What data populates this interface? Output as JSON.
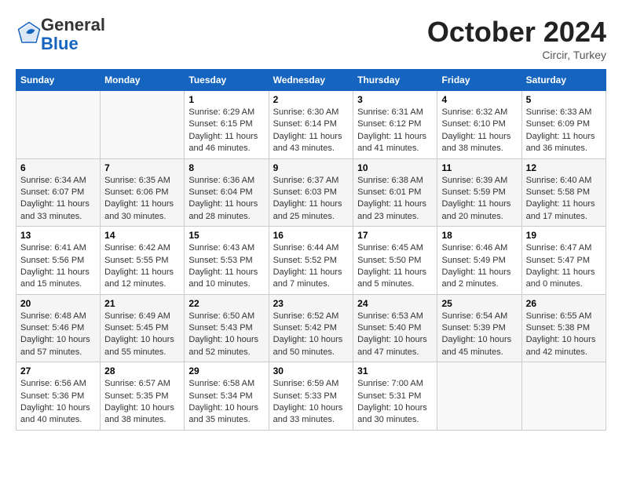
{
  "header": {
    "logo_line1": "General",
    "logo_line2": "Blue",
    "month": "October 2024",
    "location": "Circir, Turkey"
  },
  "days_of_week": [
    "Sunday",
    "Monday",
    "Tuesday",
    "Wednesday",
    "Thursday",
    "Friday",
    "Saturday"
  ],
  "weeks": [
    [
      {
        "day": "",
        "sunrise": "",
        "sunset": "",
        "daylight": ""
      },
      {
        "day": "",
        "sunrise": "",
        "sunset": "",
        "daylight": ""
      },
      {
        "day": "1",
        "sunrise": "Sunrise: 6:29 AM",
        "sunset": "Sunset: 6:15 PM",
        "daylight": "Daylight: 11 hours and 46 minutes."
      },
      {
        "day": "2",
        "sunrise": "Sunrise: 6:30 AM",
        "sunset": "Sunset: 6:14 PM",
        "daylight": "Daylight: 11 hours and 43 minutes."
      },
      {
        "day": "3",
        "sunrise": "Sunrise: 6:31 AM",
        "sunset": "Sunset: 6:12 PM",
        "daylight": "Daylight: 11 hours and 41 minutes."
      },
      {
        "day": "4",
        "sunrise": "Sunrise: 6:32 AM",
        "sunset": "Sunset: 6:10 PM",
        "daylight": "Daylight: 11 hours and 38 minutes."
      },
      {
        "day": "5",
        "sunrise": "Sunrise: 6:33 AM",
        "sunset": "Sunset: 6:09 PM",
        "daylight": "Daylight: 11 hours and 36 minutes."
      }
    ],
    [
      {
        "day": "6",
        "sunrise": "Sunrise: 6:34 AM",
        "sunset": "Sunset: 6:07 PM",
        "daylight": "Daylight: 11 hours and 33 minutes."
      },
      {
        "day": "7",
        "sunrise": "Sunrise: 6:35 AM",
        "sunset": "Sunset: 6:06 PM",
        "daylight": "Daylight: 11 hours and 30 minutes."
      },
      {
        "day": "8",
        "sunrise": "Sunrise: 6:36 AM",
        "sunset": "Sunset: 6:04 PM",
        "daylight": "Daylight: 11 hours and 28 minutes."
      },
      {
        "day": "9",
        "sunrise": "Sunrise: 6:37 AM",
        "sunset": "Sunset: 6:03 PM",
        "daylight": "Daylight: 11 hours and 25 minutes."
      },
      {
        "day": "10",
        "sunrise": "Sunrise: 6:38 AM",
        "sunset": "Sunset: 6:01 PM",
        "daylight": "Daylight: 11 hours and 23 minutes."
      },
      {
        "day": "11",
        "sunrise": "Sunrise: 6:39 AM",
        "sunset": "Sunset: 5:59 PM",
        "daylight": "Daylight: 11 hours and 20 minutes."
      },
      {
        "day": "12",
        "sunrise": "Sunrise: 6:40 AM",
        "sunset": "Sunset: 5:58 PM",
        "daylight": "Daylight: 11 hours and 17 minutes."
      }
    ],
    [
      {
        "day": "13",
        "sunrise": "Sunrise: 6:41 AM",
        "sunset": "Sunset: 5:56 PM",
        "daylight": "Daylight: 11 hours and 15 minutes."
      },
      {
        "day": "14",
        "sunrise": "Sunrise: 6:42 AM",
        "sunset": "Sunset: 5:55 PM",
        "daylight": "Daylight: 11 hours and 12 minutes."
      },
      {
        "day": "15",
        "sunrise": "Sunrise: 6:43 AM",
        "sunset": "Sunset: 5:53 PM",
        "daylight": "Daylight: 11 hours and 10 minutes."
      },
      {
        "day": "16",
        "sunrise": "Sunrise: 6:44 AM",
        "sunset": "Sunset: 5:52 PM",
        "daylight": "Daylight: 11 hours and 7 minutes."
      },
      {
        "day": "17",
        "sunrise": "Sunrise: 6:45 AM",
        "sunset": "Sunset: 5:50 PM",
        "daylight": "Daylight: 11 hours and 5 minutes."
      },
      {
        "day": "18",
        "sunrise": "Sunrise: 6:46 AM",
        "sunset": "Sunset: 5:49 PM",
        "daylight": "Daylight: 11 hours and 2 minutes."
      },
      {
        "day": "19",
        "sunrise": "Sunrise: 6:47 AM",
        "sunset": "Sunset: 5:47 PM",
        "daylight": "Daylight: 11 hours and 0 minutes."
      }
    ],
    [
      {
        "day": "20",
        "sunrise": "Sunrise: 6:48 AM",
        "sunset": "Sunset: 5:46 PM",
        "daylight": "Daylight: 10 hours and 57 minutes."
      },
      {
        "day": "21",
        "sunrise": "Sunrise: 6:49 AM",
        "sunset": "Sunset: 5:45 PM",
        "daylight": "Daylight: 10 hours and 55 minutes."
      },
      {
        "day": "22",
        "sunrise": "Sunrise: 6:50 AM",
        "sunset": "Sunset: 5:43 PM",
        "daylight": "Daylight: 10 hours and 52 minutes."
      },
      {
        "day": "23",
        "sunrise": "Sunrise: 6:52 AM",
        "sunset": "Sunset: 5:42 PM",
        "daylight": "Daylight: 10 hours and 50 minutes."
      },
      {
        "day": "24",
        "sunrise": "Sunrise: 6:53 AM",
        "sunset": "Sunset: 5:40 PM",
        "daylight": "Daylight: 10 hours and 47 minutes."
      },
      {
        "day": "25",
        "sunrise": "Sunrise: 6:54 AM",
        "sunset": "Sunset: 5:39 PM",
        "daylight": "Daylight: 10 hours and 45 minutes."
      },
      {
        "day": "26",
        "sunrise": "Sunrise: 6:55 AM",
        "sunset": "Sunset: 5:38 PM",
        "daylight": "Daylight: 10 hours and 42 minutes."
      }
    ],
    [
      {
        "day": "27",
        "sunrise": "Sunrise: 6:56 AM",
        "sunset": "Sunset: 5:36 PM",
        "daylight": "Daylight: 10 hours and 40 minutes."
      },
      {
        "day": "28",
        "sunrise": "Sunrise: 6:57 AM",
        "sunset": "Sunset: 5:35 PM",
        "daylight": "Daylight: 10 hours and 38 minutes."
      },
      {
        "day": "29",
        "sunrise": "Sunrise: 6:58 AM",
        "sunset": "Sunset: 5:34 PM",
        "daylight": "Daylight: 10 hours and 35 minutes."
      },
      {
        "day": "30",
        "sunrise": "Sunrise: 6:59 AM",
        "sunset": "Sunset: 5:33 PM",
        "daylight": "Daylight: 10 hours and 33 minutes."
      },
      {
        "day": "31",
        "sunrise": "Sunrise: 7:00 AM",
        "sunset": "Sunset: 5:31 PM",
        "daylight": "Daylight: 10 hours and 30 minutes."
      },
      {
        "day": "",
        "sunrise": "",
        "sunset": "",
        "daylight": ""
      },
      {
        "day": "",
        "sunrise": "",
        "sunset": "",
        "daylight": ""
      }
    ]
  ]
}
